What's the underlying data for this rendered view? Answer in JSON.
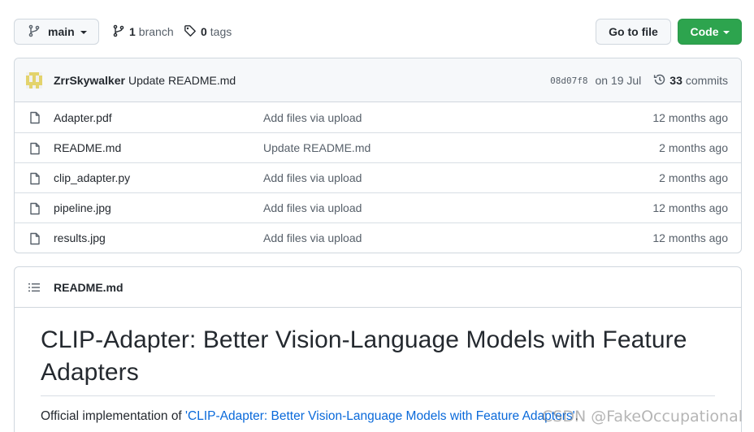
{
  "toolbar": {
    "branch_name": "main",
    "branch_count": "1",
    "branch_word": "branch",
    "tag_count": "0",
    "tag_word": "tags",
    "go_to_file": "Go to file",
    "code": "Code"
  },
  "latest_commit": {
    "author": "ZrrSkywalker",
    "message": "Update README.md",
    "sha": "08d07f8",
    "date": "on 19 Jul",
    "commit_count": "33",
    "commit_word": "commits"
  },
  "files": [
    {
      "name": "Adapter.pdf",
      "message": "Add files via upload",
      "age": "12 months ago"
    },
    {
      "name": "README.md",
      "message": "Update README.md",
      "age": "2 months ago"
    },
    {
      "name": "clip_adapter.py",
      "message": "Add files via upload",
      "age": "2 months ago"
    },
    {
      "name": "pipeline.jpg",
      "message": "Add files via upload",
      "age": "12 months ago"
    },
    {
      "name": "results.jpg",
      "message": "Add files via upload",
      "age": "12 months ago"
    }
  ],
  "readme": {
    "header": "README.md",
    "heading": "CLIP-Adapter: Better Vision-Language Models with Feature Adapters",
    "intro_prefix": "Official implementation of ",
    "intro_link": "'CLIP-Adapter: Better Vision-Language Models with Feature Adapters'",
    "intro_suffix": "."
  },
  "watermark": "CSDN @FakeOccupational",
  "colors": {
    "code_button": "#2da44e",
    "link": "#0969da",
    "header_bg": "#f6f8fa",
    "border": "#d0d7de"
  }
}
